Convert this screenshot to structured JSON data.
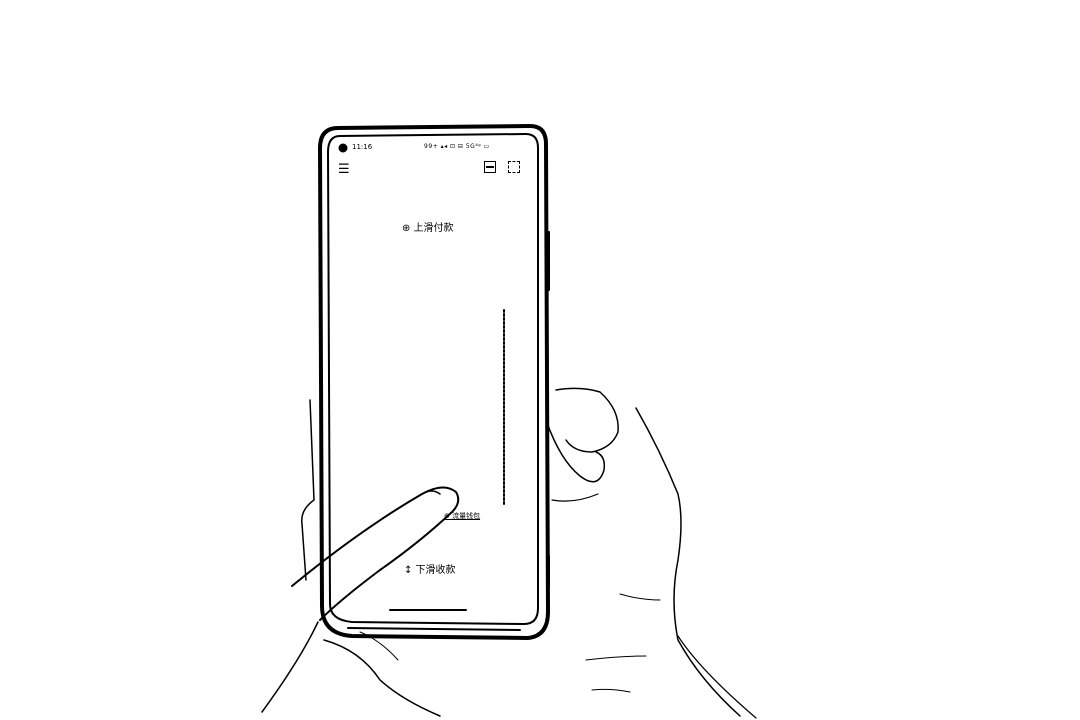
{
  "phone": {
    "status_bar": {
      "time": "11:16",
      "icons": "99+ ▴◂ ⊡ ⊟ 5G⁴ᵍ ▭"
    },
    "toolbar": {
      "menu_icon": "menu-icon",
      "scan_icon": "scan-icon",
      "qr_icon": "qr-code-icon"
    },
    "labels": {
      "top": "⊕ 上滑付款",
      "middle": "⊕ 流量钱包",
      "bottom": "↕ 下滑收款"
    }
  }
}
